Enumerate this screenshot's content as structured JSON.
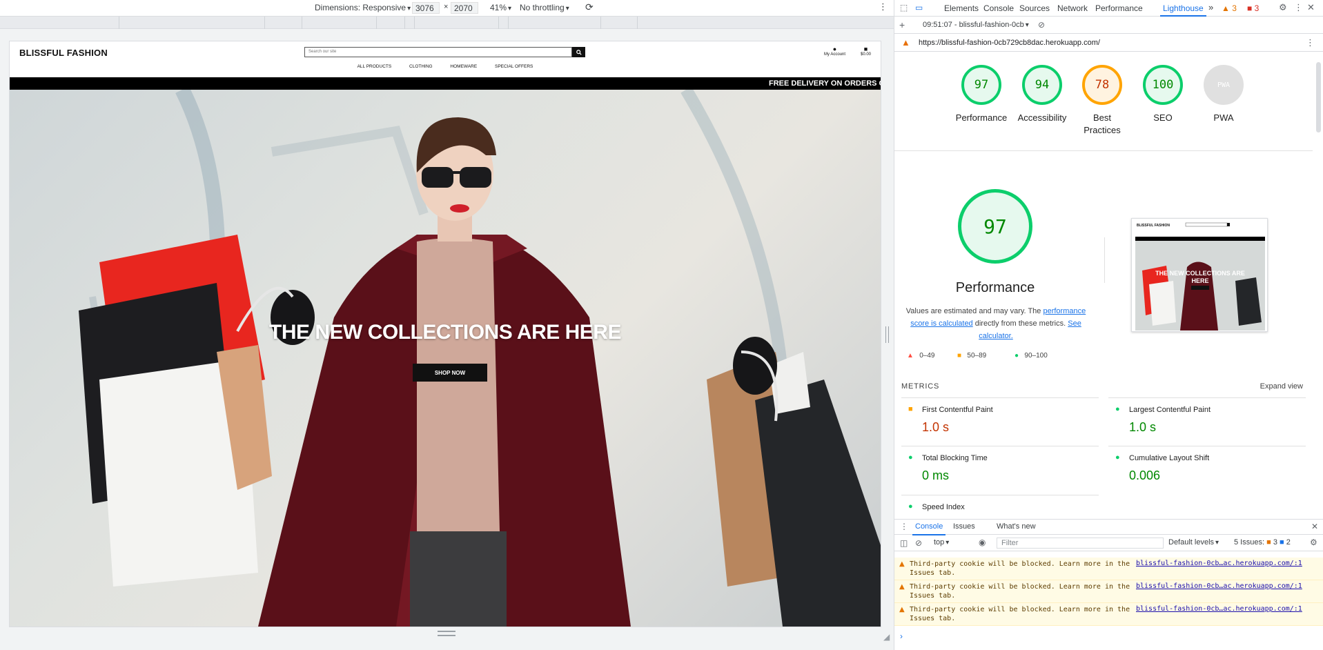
{
  "device_toolbar": {
    "dimensions_label": "Dimensions: Responsive",
    "width": "3076",
    "times": "×",
    "height": "2070",
    "zoom": "41%",
    "throttling": "No throttling"
  },
  "website": {
    "brand": "BLISSFUL FASHION",
    "search_placeholder": "Search our site",
    "account_label": "My Account",
    "bag_total": "$0.00",
    "nav": [
      "ALL PRODUCTS",
      "CLOTHING",
      "HOMEWARE",
      "SPECIAL OFFERS"
    ],
    "banner_text": "FREE DELIVERY ON ORDERS O",
    "hero_title": "THE NEW COLLECTIONS ARE HERE",
    "hero_button": "SHOP NOW"
  },
  "devtools": {
    "tabs": [
      "Elements",
      "Console",
      "Sources",
      "Network",
      "Performance",
      "Lighthouse"
    ],
    "more_tabs": "»",
    "warnings_count": "3",
    "issues_count": "3",
    "lighthouse_run": "09:51:07 - blissful-fashion-0cb",
    "report_url": "https://blissful-fashion-0cb729cb8dac.herokuapp.com/"
  },
  "scores": [
    {
      "label_line1": "Performance",
      "label_line2": "",
      "value": "97",
      "status": "pass"
    },
    {
      "label_line1": "Accessibility",
      "label_line2": "",
      "value": "94",
      "status": "pass"
    },
    {
      "label_line1": "Best",
      "label_line2": "Practices",
      "value": "78",
      "status": "average"
    },
    {
      "label_line1": "SEO",
      "label_line2": "",
      "value": "100",
      "status": "pass"
    },
    {
      "label_line1": "PWA",
      "label_line2": "",
      "value": "PWA",
      "status": "na"
    }
  ],
  "performance": {
    "score": "97",
    "title": "Performance",
    "desc_part1": "Values are estimated and may vary. The ",
    "desc_link1": "performance score is calculated",
    "desc_part2": " directly from these metrics. ",
    "desc_link2": "See calculator.",
    "legend": [
      {
        "icon": "▲",
        "range": "0–49"
      },
      {
        "icon": "■",
        "range": "50–89"
      },
      {
        "icon": "●",
        "range": "90–100"
      }
    ]
  },
  "metrics": {
    "heading": "METRICS",
    "expand": "Expand view",
    "items": [
      {
        "name": "First Contentful Paint",
        "value": "1.0 s",
        "status": "average",
        "icon": "■"
      },
      {
        "name": "Largest Contentful Paint",
        "value": "1.0 s",
        "status": "pass",
        "icon": "●"
      },
      {
        "name": "Total Blocking Time",
        "value": "0 ms",
        "status": "pass",
        "icon": "●"
      },
      {
        "name": "Cumulative Layout Shift",
        "value": "0.006",
        "status": "pass",
        "icon": "●"
      },
      {
        "name": "Speed Index",
        "value": "",
        "status": "pass",
        "icon": "●"
      }
    ]
  },
  "drawer": {
    "tabs": [
      "Console",
      "Issues",
      "What's new"
    ],
    "context": "top",
    "filter_placeholder": "Filter",
    "levels": "Default levels",
    "issues_label": "5 Issues:",
    "issues_warn": "3",
    "issues_info": "2",
    "messages": [
      {
        "text": "Third-party cookie will be blocked. Learn more in the Issues tab.",
        "source": "blissful-fashion-0cb…ac.herokuapp.com/:1"
      },
      {
        "text": "Third-party cookie will be blocked. Learn more in the Issues tab.",
        "source": "blissful-fashion-0cb…ac.herokuapp.com/:1"
      },
      {
        "text": "Third-party cookie will be blocked. Learn more in the Issues tab.",
        "source": "blissful-fashion-0cb…ac.herokuapp.com/:1"
      }
    ],
    "prompt": "›"
  },
  "colors": {
    "pass": "#0cce6b",
    "average": "#ffa400",
    "fail": "#ff4e42",
    "accent": "#1a73e8"
  }
}
